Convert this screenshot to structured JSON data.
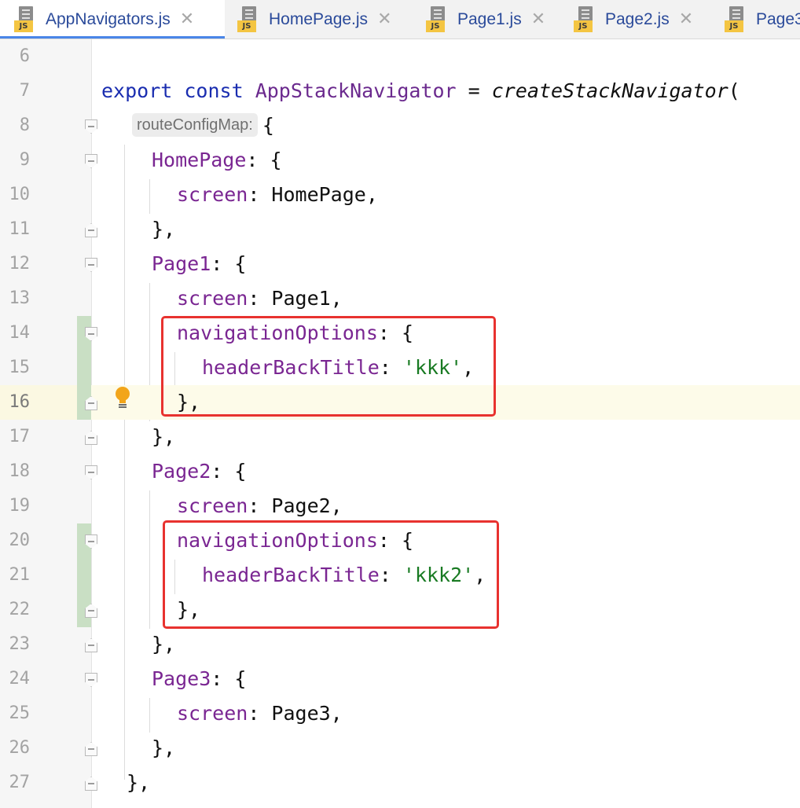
{
  "tabs": [
    {
      "label": "AppNavigators.js",
      "active": true,
      "icon": "js-file-icon",
      "badge": "JS"
    },
    {
      "label": "HomePage.js",
      "active": false,
      "icon": "js-file-icon",
      "badge": "JS"
    },
    {
      "label": "Page1.js",
      "active": false,
      "icon": "js-file-icon",
      "badge": "JS"
    },
    {
      "label": "Page2.js",
      "active": false,
      "icon": "js-file-icon",
      "badge": "JS"
    },
    {
      "label": "Page3",
      "active": false,
      "icon": "js-file-icon",
      "badge": "JS"
    }
  ],
  "tab_close_glyph": "✕",
  "editor": {
    "current_line": "16",
    "lines": [
      {
        "n": "6"
      },
      {
        "n": "7",
        "tokens": {
          "export": "export",
          "const": "const",
          "name": "AppStackNavigator",
          "eq": " = ",
          "call": "createStackNavigator",
          "paren": "("
        }
      },
      {
        "n": "8",
        "hint": "routeConfigMap:",
        "text": "{"
      },
      {
        "n": "9",
        "key": "HomePage",
        "rest": ": {"
      },
      {
        "n": "10",
        "key": "screen",
        "rest": ": HomePage,"
      },
      {
        "n": "11",
        "text": "},"
      },
      {
        "n": "12",
        "key": "Page1",
        "rest": ": {"
      },
      {
        "n": "13",
        "key": "screen",
        "rest": ": Page1,"
      },
      {
        "n": "14",
        "key": "navigationOptions",
        "rest": ": {"
      },
      {
        "n": "15",
        "key": "headerBackTitle",
        "sep": ": ",
        "str": "'kkk'",
        "tail": ","
      },
      {
        "n": "16",
        "text": "},"
      },
      {
        "n": "17",
        "text": "},"
      },
      {
        "n": "18",
        "key": "Page2",
        "rest": ": {"
      },
      {
        "n": "19",
        "key": "screen",
        "rest": ": Page2,"
      },
      {
        "n": "20",
        "key": "navigationOptions",
        "rest": ": {"
      },
      {
        "n": "21",
        "key": "headerBackTitle",
        "sep": ": ",
        "str": "'kkk2'",
        "tail": ","
      },
      {
        "n": "22",
        "text": "},"
      },
      {
        "n": "23",
        "text": "},"
      },
      {
        "n": "24",
        "key": "Page3",
        "rest": ": {"
      },
      {
        "n": "25",
        "key": "screen",
        "rest": ": Page3,"
      },
      {
        "n": "26",
        "text": "},"
      },
      {
        "n": "27",
        "text": "},"
      }
    ]
  },
  "colors": {
    "keyword": "#1a2db0",
    "property": "#7a2692",
    "string": "#187a22",
    "highlight_box": "#e8322f",
    "current_line": "#fdfbe9",
    "vcs_changed": "#c9dfc4"
  },
  "icons": {
    "intention_bulb": "lightbulb-icon",
    "fold_open": "fold-open-icon",
    "fold_close": "fold-close-icon"
  }
}
